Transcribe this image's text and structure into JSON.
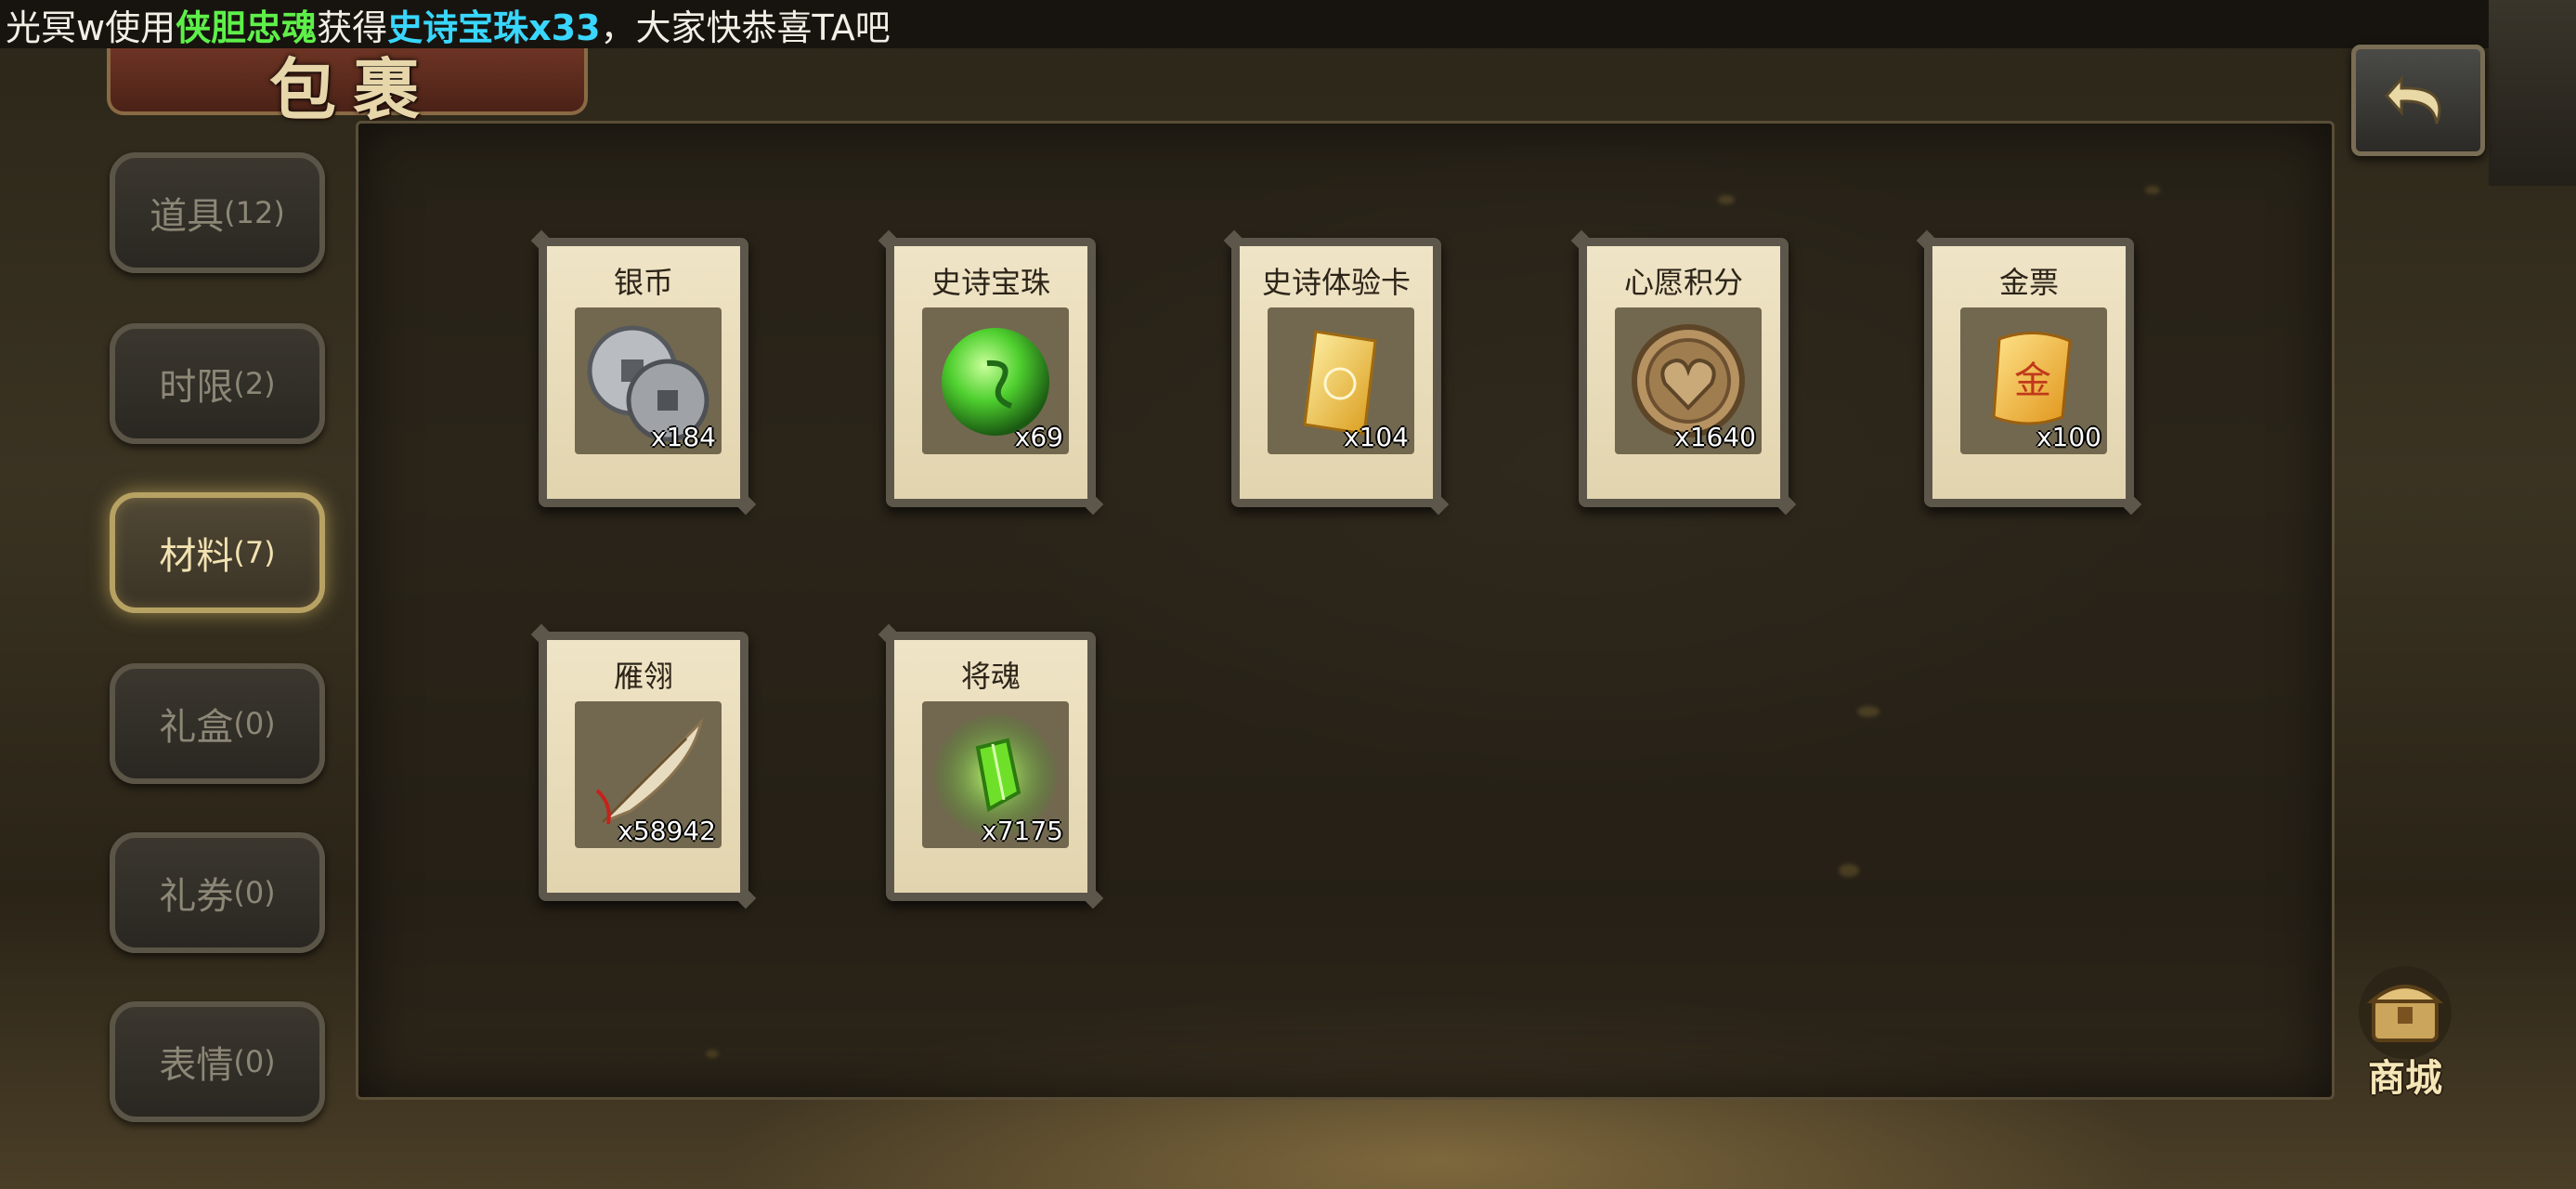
{
  "marquee": {
    "player": "光冥w",
    "verb1": "使用",
    "item_used": "侠胆忠魂",
    "verb2": "获得",
    "reward": "史诗宝珠x33",
    "suffix": "，大家快恭喜TA吧"
  },
  "header": {
    "title": "包裹"
  },
  "sidebar": {
    "tabs": [
      {
        "label": "道具",
        "count": "(12)",
        "active": false
      },
      {
        "label": "时限",
        "count": "(2)",
        "active": false
      },
      {
        "label": "材料",
        "count": "(7)",
        "active": true
      },
      {
        "label": "礼盒",
        "count": "(0)",
        "active": false
      },
      {
        "label": "礼券",
        "count": "(0)",
        "active": false
      },
      {
        "label": "表情",
        "count": "(0)",
        "active": false
      }
    ]
  },
  "items": [
    {
      "name": "银币",
      "qty": "x184",
      "icon": "silver-coin-icon"
    },
    {
      "name": "史诗宝珠",
      "qty": "x69",
      "icon": "epic-orb-icon"
    },
    {
      "name": "史诗体验卡",
      "qty": "x104",
      "icon": "epic-trial-card-icon"
    },
    {
      "name": "心愿积分",
      "qty": "x1640",
      "icon": "wish-points-coin-icon"
    },
    {
      "name": "金票",
      "qty": "x100",
      "icon": "gold-ticket-icon"
    },
    {
      "name": "雁翎",
      "qty": "x58942",
      "icon": "feather-icon"
    },
    {
      "name": "将魂",
      "qty": "x7175",
      "icon": "general-soul-crystal-icon"
    }
  ],
  "shop": {
    "label": "商城",
    "icon": "shop-chest-icon"
  },
  "colors": {
    "active_tab_border": "#b7a263",
    "card_bg": "#efe4c6",
    "marquee_green": "#5ef04a",
    "marquee_cyan": "#39d7ff"
  }
}
